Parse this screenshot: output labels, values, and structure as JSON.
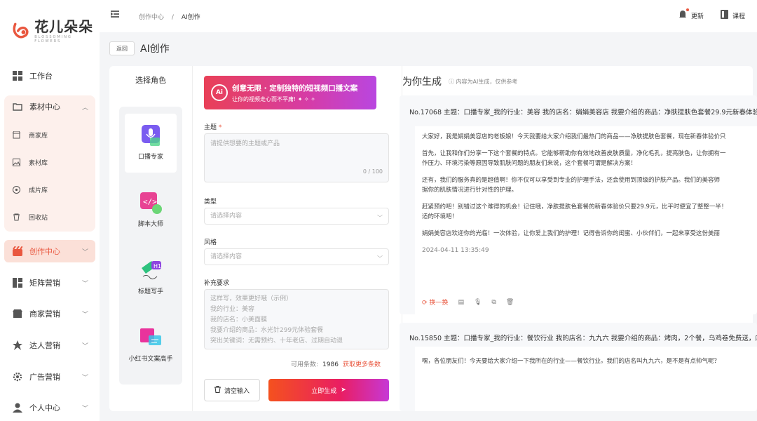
{
  "brand": {
    "name": "花儿朵朵",
    "sub": "BLOSSOMING FLOWERS"
  },
  "sidebar": {
    "workbench": "工作台",
    "material_center": "素材中心",
    "material_sub": [
      "商家库",
      "素材库",
      "成片库",
      "回收站"
    ],
    "creation_center": "创作中心",
    "matrix": "矩阵营销",
    "merchant": "商家营销",
    "influencer": "达人营销",
    "ads": "广告营销",
    "personal": "个人中心"
  },
  "header": {
    "breadcrumb": [
      "创作中心",
      "/",
      "AI创作"
    ],
    "update": "更新",
    "course": "课程"
  },
  "titlebar": {
    "back": "返回",
    "title": "AI创作"
  },
  "roles": {
    "heading": "选择角色",
    "items": [
      "口播专家",
      "脚本大师",
      "标题写手",
      "小红书文案高手"
    ]
  },
  "form": {
    "banner_title": "创意无限 · 定制独特的短视频口播文案",
    "banner_sub": "让你的视频走心而不平庸!",
    "banner_badge": "Ai",
    "topic_label": "主题",
    "required_mark": "*",
    "topic_placeholder": "请提供想要的主题或产品",
    "topic_counter": "0 / 100",
    "type_label": "类型",
    "type_placeholder": "请选择内容",
    "style_label": "风格",
    "style_placeholder": "请选择内容",
    "extra_label": "补充要求",
    "extra_lines": [
      "这样写，效果更好哦（示例）",
      "我的行业：美容",
      "我的店名：小美面膜",
      "我要介绍的商品：水光针299元体验套餐",
      "突出关键词：无需预约、十年老店、过期自动退"
    ],
    "avail_label": "可用条数:",
    "avail_count": "1986",
    "avail_link": "获取更多条数",
    "clear_btn": "清空输入",
    "generate_btn": "立即生成"
  },
  "results": {
    "title": "为你生成",
    "note": "内容为AI生成，仅供参考",
    "items": [
      {
        "head": "No.17068 主题：口播专家_我的行业：美容 我的店名：娟娟美容店 我要介绍的商品：净肤提肤色套餐29.9元新春体验",
        "paras": [
          "大家好，我是娟娟美容店的老板娘！今天我要给大家介绍我们最热门的商品——净肤提肤色套餐，现在新春体验价只",
          "首先，让我和你们分享一下这个套餐的特点。它能够帮助你有效地改善皮肤质量，净化毛孔，提亮肤色，让你拥有一",
          "作压力、环境污染等原因导致肌肤问题的朋友们来说，这个套餐可谓是解决方案！",
          "还有，我们的服务真的是超值啊！你不仅可以享受到专业的护理手法，还会使用到顶级的护肤产品。我们的美容师",
          "据你的肌肤情况进行针对性的护理。",
          "赶紧预约吧！别错过这个难得的机会！记住哦，净肤提肤色套餐的新春体验价只要29.9元，比平时便宜了整整一半！",
          "适的环境吧！",
          "娟娟美容店欢迎你的光临！一次体验，让你爱上我们的护理！记得告诉你的闺蜜、小伙伴们，一起来享受这份美丽"
        ],
        "date": "2024-04-11 13:35:49",
        "action": "换一换"
      },
      {
        "head": "No.15850 主题：口播专家_我的行业：餐饮行业 我的店名：九九六 我要介绍的商品：烤肉，2个餐，乌鸡卷免费送，内",
        "paras": [
          "嘿，各位朋友们！今天要给大家介绍一下我所在的行业——餐饮行业。我们的店名叫九九六，是不是有点帅气呢？"
        ]
      }
    ]
  },
  "colors": {
    "accent": "#e9573f",
    "sidebar_active": "#fbe0d8"
  }
}
